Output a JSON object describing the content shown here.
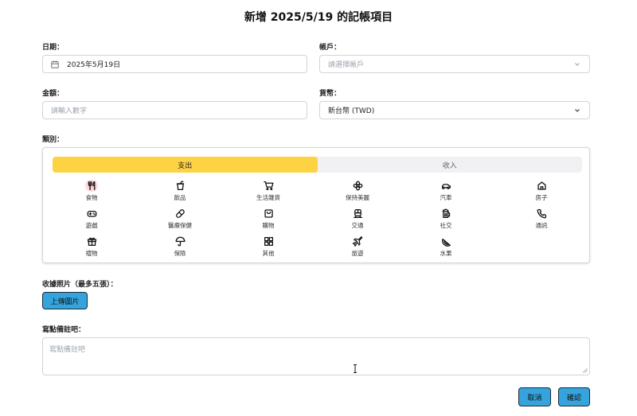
{
  "header": {
    "title": "新增 2025/5/19 的記帳項目"
  },
  "form": {
    "date": {
      "label": "日期：",
      "value": "2025年5月19日"
    },
    "account": {
      "label": "帳戶：",
      "placeholder": "請選擇帳戶"
    },
    "amount": {
      "label": "金額：",
      "placeholder": "請輸入數字"
    },
    "currency": {
      "label": "貨幣：",
      "value": "新台幣 (TWD)"
    },
    "category": {
      "label": "類別：",
      "tabs": [
        {
          "label": "支出",
          "active": true
        },
        {
          "label": "收入",
          "active": false
        }
      ],
      "items": [
        {
          "label": "食物",
          "icon": "utensils-icon",
          "selected": true
        },
        {
          "label": "飲品",
          "icon": "cup-icon"
        },
        {
          "label": "生活雜貨",
          "icon": "cart-icon"
        },
        {
          "label": "保持美麗",
          "icon": "flower-icon"
        },
        {
          "label": "汽車",
          "icon": "car-icon"
        },
        {
          "label": "房子",
          "icon": "house-icon"
        },
        {
          "label": "遊戲",
          "icon": "gamepad-icon"
        },
        {
          "label": "醫療保健",
          "icon": "pill-icon"
        },
        {
          "label": "購物",
          "icon": "shopping-bag-icon"
        },
        {
          "label": "交通",
          "icon": "train-icon"
        },
        {
          "label": "社交",
          "icon": "beer-icon"
        },
        {
          "label": "通訊",
          "icon": "phone-icon"
        },
        {
          "label": "禮物",
          "icon": "gift-icon"
        },
        {
          "label": "保險",
          "icon": "umbrella-icon"
        },
        {
          "label": "其他",
          "icon": "grid-icon"
        },
        {
          "label": "旅遊",
          "icon": "plane-icon"
        },
        {
          "label": "水果",
          "icon": "watermelon-icon"
        }
      ]
    },
    "receipt": {
      "label": "收據照片（最多五張）：",
      "upload_label": "上傳圖片"
    },
    "notes": {
      "label": "寫點備註吧：",
      "placeholder": "寫點備註吧"
    }
  },
  "footer": {
    "cancel_label": "取消",
    "confirm_label": "確認"
  }
}
